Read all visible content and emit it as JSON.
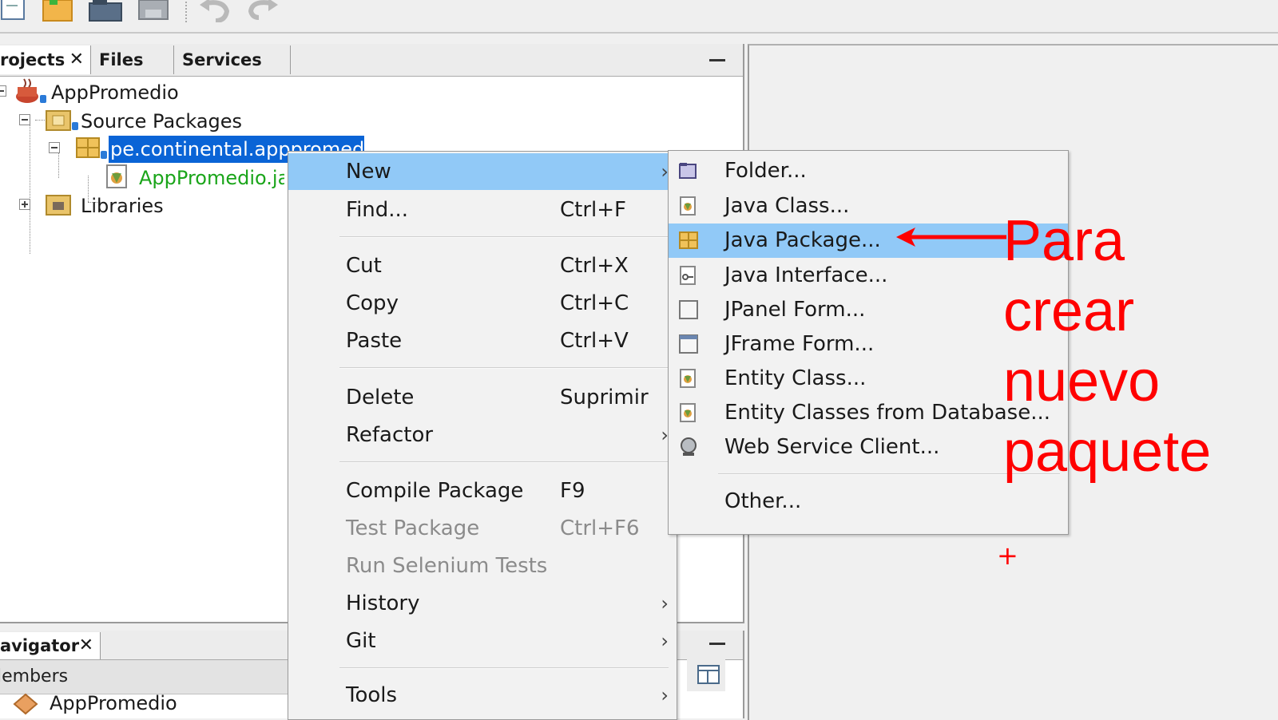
{
  "toolbar": {
    "buttons": [
      "new-file-icon",
      "new-project-icon",
      "open-project-icon",
      "save-all-icon",
      "undo-icon",
      "redo-icon"
    ]
  },
  "projects_panel": {
    "tabs": [
      {
        "label": "rojects",
        "closable": true,
        "active": true
      },
      {
        "label": "Files",
        "closable": false,
        "active": false
      },
      {
        "label": "Services",
        "closable": false,
        "active": false
      }
    ],
    "tree": {
      "project": "AppPromedio",
      "source_packages": "Source Packages",
      "package": "pe.continental.apppromedio",
      "file": "AppPromedio.ja",
      "libraries": "Libraries"
    }
  },
  "navigator_panel": {
    "tab_label": "avigator",
    "members_label": "lembers",
    "item": "AppPromedio"
  },
  "context_menu": {
    "items": [
      {
        "label": "New",
        "shortcut": "",
        "submenu": true,
        "highlighted": true,
        "disabled": false
      },
      {
        "label": "Find...",
        "shortcut": "Ctrl+F",
        "submenu": false,
        "highlighted": false,
        "disabled": false
      },
      {
        "label": "Cut",
        "shortcut": "Ctrl+X",
        "submenu": false,
        "highlighted": false,
        "disabled": false
      },
      {
        "label": "Copy",
        "shortcut": "Ctrl+C",
        "submenu": false,
        "highlighted": false,
        "disabled": false
      },
      {
        "label": "Paste",
        "shortcut": "Ctrl+V",
        "submenu": false,
        "highlighted": false,
        "disabled": false
      },
      {
        "label": "Delete",
        "shortcut": "Suprimir",
        "submenu": false,
        "highlighted": false,
        "disabled": false
      },
      {
        "label": "Refactor",
        "shortcut": "",
        "submenu": true,
        "highlighted": false,
        "disabled": false
      },
      {
        "label": "Compile Package",
        "shortcut": "F9",
        "submenu": false,
        "highlighted": false,
        "disabled": false
      },
      {
        "label": "Test Package",
        "shortcut": "Ctrl+F6",
        "submenu": false,
        "highlighted": false,
        "disabled": true
      },
      {
        "label": "Run Selenium Tests",
        "shortcut": "",
        "submenu": false,
        "highlighted": false,
        "disabled": true
      },
      {
        "label": "History",
        "shortcut": "",
        "submenu": true,
        "highlighted": false,
        "disabled": false
      },
      {
        "label": "Git",
        "shortcut": "",
        "submenu": true,
        "highlighted": false,
        "disabled": false
      },
      {
        "label": "Tools",
        "shortcut": "",
        "submenu": true,
        "highlighted": false,
        "disabled": false
      }
    ]
  },
  "new_submenu": {
    "items": [
      {
        "label": "Folder...",
        "icon": "folder-icon",
        "highlighted": false
      },
      {
        "label": "Java Class...",
        "icon": "java-class-icon",
        "highlighted": false
      },
      {
        "label": "Java Package...",
        "icon": "java-package-icon",
        "highlighted": true
      },
      {
        "label": "Java Interface...",
        "icon": "java-interface-icon",
        "highlighted": false
      },
      {
        "label": "JPanel Form...",
        "icon": "jpanel-form-icon",
        "highlighted": false
      },
      {
        "label": "JFrame Form...",
        "icon": "jframe-form-icon",
        "highlighted": false
      },
      {
        "label": "Entity Class...",
        "icon": "entity-class-icon",
        "highlighted": false
      },
      {
        "label": "Entity Classes from Database...",
        "icon": "entity-database-icon",
        "highlighted": false
      },
      {
        "label": "Web Service Client...",
        "icon": "web-service-icon",
        "highlighted": false
      },
      {
        "label": "Other...",
        "icon": "",
        "highlighted": false
      }
    ]
  },
  "annotation": {
    "lines": [
      "Para",
      "crear",
      "nuevo",
      "paquete"
    ],
    "color": "#ff0000",
    "cursor": "+"
  },
  "colors": {
    "selection": "#0a64d6",
    "menu_highlight": "#91c9f7",
    "disabled_text": "#8b8b8b",
    "source_file_text": "#1aa51a"
  }
}
